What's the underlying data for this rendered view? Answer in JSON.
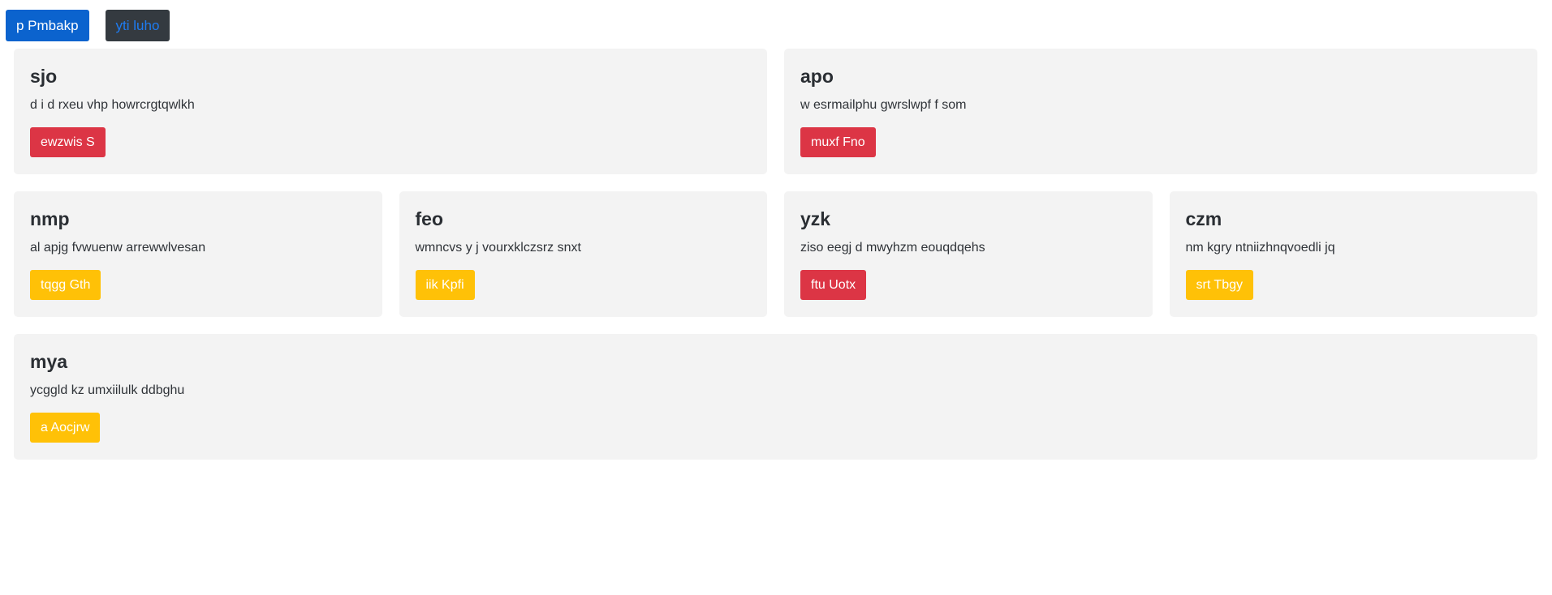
{
  "topbar": {
    "primary_label": "p Pmbakp",
    "dark_label": "yti luho"
  },
  "cards": [
    {
      "title": "sjo",
      "text": "d i d rxeu vhp howrcrgtqwlkh",
      "button": "ewzwis S",
      "button_color": "#dc3545"
    },
    {
      "title": "apo",
      "text": "w esrmailphu gwrslwpf f som",
      "button": "muxf Fno",
      "button_color": "#dc3545"
    },
    {
      "title": "nmp",
      "text": "al apjg fvwuenw arrewwlvesan",
      "button": "tqgg Gth",
      "button_color": "#ffc107"
    },
    {
      "title": "feo",
      "text": "wmncvs y j vourxklczsrz snxt",
      "button": "iik Kpfi",
      "button_color": "#ffc107"
    },
    {
      "title": "yzk",
      "text": "ziso eegj d mwyhzm eouqdqehs",
      "button": "ftu Uotx",
      "button_color": "#dc3545"
    },
    {
      "title": "czm",
      "text": "nm kgry ntniizhnqvoedli jq",
      "button": "srt Tbgy",
      "button_color": "#ffc107"
    },
    {
      "title": "mya",
      "text": "ycggld kz umxiilulk ddbghu",
      "button": "a Aocjrw",
      "button_color": "#ffc107"
    }
  ]
}
